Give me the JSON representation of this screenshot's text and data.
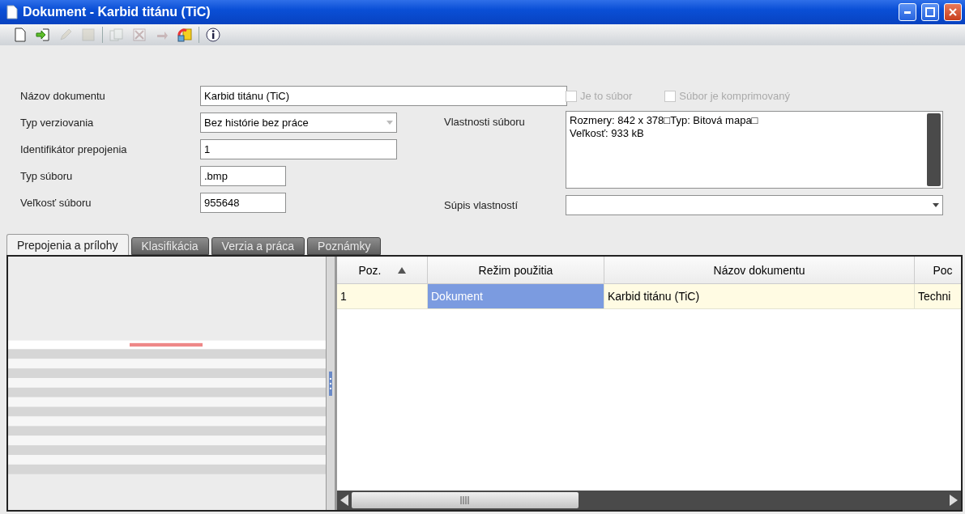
{
  "window": {
    "title": "Dokument - Karbid titánu (TiC)"
  },
  "toolbar": {
    "groups": [
      {
        "buttons": [
          {
            "kind": "new",
            "disabled": false
          },
          {
            "kind": "import",
            "disabled": false
          },
          {
            "kind": "edit",
            "disabled": true
          },
          {
            "kind": "save",
            "disabled": true
          }
        ]
      },
      {
        "buttons": [
          {
            "kind": "copy",
            "disabled": true
          },
          {
            "kind": "delete",
            "disabled": true
          },
          {
            "kind": "undo",
            "disabled": true
          },
          {
            "kind": "refresh",
            "disabled": false
          }
        ]
      },
      {
        "buttons": [
          {
            "kind": "info",
            "disabled": false
          }
        ]
      }
    ]
  },
  "form": {
    "fields": [
      {
        "label": "Názov dokumentu",
        "value": "Karbid titánu (TiC)",
        "kind": "text"
      },
      {
        "label": "Typ verziovania",
        "value": "Bez histórie bez práce",
        "kind": "select"
      },
      {
        "label": "Identifikátor prepojenia",
        "value": "1",
        "kind": "text"
      },
      {
        "label": "Typ súboru",
        "value": ".bmp",
        "kind": "text"
      },
      {
        "label": "Veľkosť súboru",
        "value": "955648",
        "kind": "text"
      }
    ],
    "checkboxes": [
      {
        "label": "Je to súbor",
        "checked": false,
        "disabled": true
      },
      {
        "label": "Súbor je komprimovaný",
        "checked": false,
        "disabled": true
      }
    ],
    "file_properties": {
      "label": "Vlastnosti súboru",
      "lines": [
        "Rozmery: 842 x 378□Typ: Bitová mapa□",
        "Veľkosť: 933 kB"
      ]
    },
    "property_list": {
      "label": "Súpis vlastností"
    }
  },
  "tabs": [
    {
      "label": "Prepojenia a prílohy",
      "selected": true
    },
    {
      "label": "Klasifikácia",
      "selected": false
    },
    {
      "label": "Verzia a práca",
      "selected": false
    },
    {
      "label": "Poznámky",
      "selected": false
    }
  ],
  "table": {
    "columns": [
      {
        "label": "Poz.",
        "sorted": true
      },
      {
        "label": "Režim použitia",
        "sorted": false
      },
      {
        "label": "Názov dokumentu",
        "sorted": false
      },
      {
        "label": "Poc",
        "sorted": false
      }
    ],
    "rows": [
      {
        "selected": true,
        "cells": [
          {
            "text": "1",
            "focused": false
          },
          {
            "text": "Dokument",
            "focused": true
          },
          {
            "text": "Karbid titánu (TiC)",
            "focused": false
          },
          {
            "text": "Techni",
            "focused": false
          }
        ]
      }
    ]
  }
}
